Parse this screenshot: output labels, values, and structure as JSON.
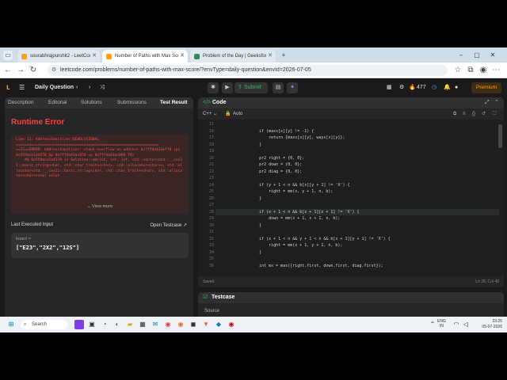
{
  "browser": {
    "tabs": [
      {
        "title": "sourabhrajpurohit2 - LeetCode P"
      },
      {
        "title": "Number of Paths with Max Score"
      },
      {
        "title": "Problem of the Day | GeeksforGe"
      }
    ],
    "url": "leetcode.com/problems/number-of-paths-with-max-score/?envType=daily-question&envId=2026-07-05"
  },
  "header": {
    "title": "Daily Question",
    "submit_label": "Submit",
    "streak": "477",
    "premium_label": "Premium"
  },
  "left_tabs": [
    {
      "label": "Description"
    },
    {
      "label": "Editorial"
    },
    {
      "label": "Solutions"
    },
    {
      "label": "Submissions"
    },
    {
      "label": "Test Result"
    }
  ],
  "result": {
    "title": "Runtime Error",
    "error_text": "Line 11: AddressSanitizer:DEADLYSIGNAL\n=================================================================\n==22==ERROR: AddressSanitizer: stack-overflow on address 0x7ffda43abff8 (pc 0x559ace1a4378 bp 0x7ffda43ac010 sp 0x7ffda43ac000 T0)\n    #0 0x559ace1a4378 in Solution::mm(int, int, int, std::vector<std::__cxx11::basic_string<char, std::char_traits<char>, std::allocator<char>>, std::allocator<std::__cxx11::basic_string<char, std::char_traits<char>, std::allocator<char>>>>&) solut",
    "view_more": "View more",
    "last_input_label": "Last Executed Input",
    "open_testcase": "Open Testcase",
    "input_name": "board =",
    "input_value": "[\"E23\",\"2X2\",\"12S\"]"
  },
  "code": {
    "tab_label": "Code",
    "language": "C++",
    "mode": "Auto",
    "lines": [
      {
        "n": "15",
        "t": "        "
      },
      {
        "n": "16",
        "t": "        if (maxs[x][y] != -1) {"
      },
      {
        "n": "17",
        "t": "            return {maxs[x][y], ways[x][y]};"
      },
      {
        "n": "18",
        "t": "        }"
      },
      {
        "n": "19",
        "t": ""
      },
      {
        "n": "20",
        "t": "        pr2 right = {0, 0};"
      },
      {
        "n": "21",
        "t": "        pr2 down = {0, 0};"
      },
      {
        "n": "22",
        "t": "        pr2 diag = {0, 0};"
      },
      {
        "n": "23",
        "t": ""
      },
      {
        "n": "24",
        "t": "        if (y + 1 < n && b[x][y + 1] != 'X') {"
      },
      {
        "n": "25",
        "t": "            right = mm(x, y + 1, n, b);"
      },
      {
        "n": "26",
        "t": "        }"
      },
      {
        "n": "27",
        "t": ""
      },
      {
        "n": "28",
        "t": "        if (x + 1 < n && b[x + 1][x + 1] != 'X') {"
      },
      {
        "n": "29",
        "t": "            down = mm(x + 1, x + 1, n, b);"
      },
      {
        "n": "30",
        "t": "        }"
      },
      {
        "n": "31",
        "t": ""
      },
      {
        "n": "32",
        "t": "        if (x + 1 < n && y + 1 < n && b[x + 1][y + 1] != 'X') {"
      },
      {
        "n": "33",
        "t": "            right = mm(x + 1, y + 1, n, b);"
      },
      {
        "n": "34",
        "t": "        }"
      },
      {
        "n": "35",
        "t": ""
      },
      {
        "n": "36",
        "t": "        int mx = max({right.first, down.first, diag.first});"
      }
    ],
    "status_saved": "Saved",
    "cursor": "Ln 28, Col 40"
  },
  "testcase": {
    "label": "Testcase",
    "source_label": "Source"
  },
  "taskbar": {
    "search_placeholder": "Search",
    "lang_line1": "ENG",
    "lang_line2": "IN",
    "time": "23:25",
    "date": "05-07-2026"
  },
  "colors": {
    "error_red": "#ef4743",
    "submit_green": "#2cbb5d",
    "premium_orange": "#ffa116"
  }
}
